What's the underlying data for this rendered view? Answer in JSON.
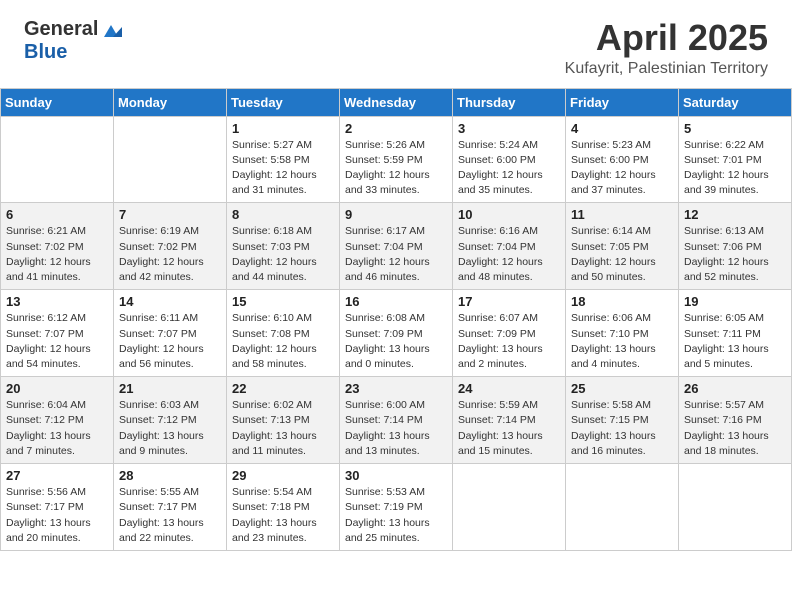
{
  "header": {
    "logo_general": "General",
    "logo_blue": "Blue",
    "month_title": "April 2025",
    "location": "Kufayrit, Palestinian Territory"
  },
  "weekdays": [
    "Sunday",
    "Monday",
    "Tuesday",
    "Wednesday",
    "Thursday",
    "Friday",
    "Saturday"
  ],
  "weeks": [
    [
      {
        "day": "",
        "info": ""
      },
      {
        "day": "",
        "info": ""
      },
      {
        "day": "1",
        "info": "Sunrise: 5:27 AM\nSunset: 5:58 PM\nDaylight: 12 hours\nand 31 minutes."
      },
      {
        "day": "2",
        "info": "Sunrise: 5:26 AM\nSunset: 5:59 PM\nDaylight: 12 hours\nand 33 minutes."
      },
      {
        "day": "3",
        "info": "Sunrise: 5:24 AM\nSunset: 6:00 PM\nDaylight: 12 hours\nand 35 minutes."
      },
      {
        "day": "4",
        "info": "Sunrise: 5:23 AM\nSunset: 6:00 PM\nDaylight: 12 hours\nand 37 minutes."
      },
      {
        "day": "5",
        "info": "Sunrise: 6:22 AM\nSunset: 7:01 PM\nDaylight: 12 hours\nand 39 minutes."
      }
    ],
    [
      {
        "day": "6",
        "info": "Sunrise: 6:21 AM\nSunset: 7:02 PM\nDaylight: 12 hours\nand 41 minutes."
      },
      {
        "day": "7",
        "info": "Sunrise: 6:19 AM\nSunset: 7:02 PM\nDaylight: 12 hours\nand 42 minutes."
      },
      {
        "day": "8",
        "info": "Sunrise: 6:18 AM\nSunset: 7:03 PM\nDaylight: 12 hours\nand 44 minutes."
      },
      {
        "day": "9",
        "info": "Sunrise: 6:17 AM\nSunset: 7:04 PM\nDaylight: 12 hours\nand 46 minutes."
      },
      {
        "day": "10",
        "info": "Sunrise: 6:16 AM\nSunset: 7:04 PM\nDaylight: 12 hours\nand 48 minutes."
      },
      {
        "day": "11",
        "info": "Sunrise: 6:14 AM\nSunset: 7:05 PM\nDaylight: 12 hours\nand 50 minutes."
      },
      {
        "day": "12",
        "info": "Sunrise: 6:13 AM\nSunset: 7:06 PM\nDaylight: 12 hours\nand 52 minutes."
      }
    ],
    [
      {
        "day": "13",
        "info": "Sunrise: 6:12 AM\nSunset: 7:07 PM\nDaylight: 12 hours\nand 54 minutes."
      },
      {
        "day": "14",
        "info": "Sunrise: 6:11 AM\nSunset: 7:07 PM\nDaylight: 12 hours\nand 56 minutes."
      },
      {
        "day": "15",
        "info": "Sunrise: 6:10 AM\nSunset: 7:08 PM\nDaylight: 12 hours\nand 58 minutes."
      },
      {
        "day": "16",
        "info": "Sunrise: 6:08 AM\nSunset: 7:09 PM\nDaylight: 13 hours\nand 0 minutes."
      },
      {
        "day": "17",
        "info": "Sunrise: 6:07 AM\nSunset: 7:09 PM\nDaylight: 13 hours\nand 2 minutes."
      },
      {
        "day": "18",
        "info": "Sunrise: 6:06 AM\nSunset: 7:10 PM\nDaylight: 13 hours\nand 4 minutes."
      },
      {
        "day": "19",
        "info": "Sunrise: 6:05 AM\nSunset: 7:11 PM\nDaylight: 13 hours\nand 5 minutes."
      }
    ],
    [
      {
        "day": "20",
        "info": "Sunrise: 6:04 AM\nSunset: 7:12 PM\nDaylight: 13 hours\nand 7 minutes."
      },
      {
        "day": "21",
        "info": "Sunrise: 6:03 AM\nSunset: 7:12 PM\nDaylight: 13 hours\nand 9 minutes."
      },
      {
        "day": "22",
        "info": "Sunrise: 6:02 AM\nSunset: 7:13 PM\nDaylight: 13 hours\nand 11 minutes."
      },
      {
        "day": "23",
        "info": "Sunrise: 6:00 AM\nSunset: 7:14 PM\nDaylight: 13 hours\nand 13 minutes."
      },
      {
        "day": "24",
        "info": "Sunrise: 5:59 AM\nSunset: 7:14 PM\nDaylight: 13 hours\nand 15 minutes."
      },
      {
        "day": "25",
        "info": "Sunrise: 5:58 AM\nSunset: 7:15 PM\nDaylight: 13 hours\nand 16 minutes."
      },
      {
        "day": "26",
        "info": "Sunrise: 5:57 AM\nSunset: 7:16 PM\nDaylight: 13 hours\nand 18 minutes."
      }
    ],
    [
      {
        "day": "27",
        "info": "Sunrise: 5:56 AM\nSunset: 7:17 PM\nDaylight: 13 hours\nand 20 minutes."
      },
      {
        "day": "28",
        "info": "Sunrise: 5:55 AM\nSunset: 7:17 PM\nDaylight: 13 hours\nand 22 minutes."
      },
      {
        "day": "29",
        "info": "Sunrise: 5:54 AM\nSunset: 7:18 PM\nDaylight: 13 hours\nand 23 minutes."
      },
      {
        "day": "30",
        "info": "Sunrise: 5:53 AM\nSunset: 7:19 PM\nDaylight: 13 hours\nand 25 minutes."
      },
      {
        "day": "",
        "info": ""
      },
      {
        "day": "",
        "info": ""
      },
      {
        "day": "",
        "info": ""
      }
    ]
  ]
}
